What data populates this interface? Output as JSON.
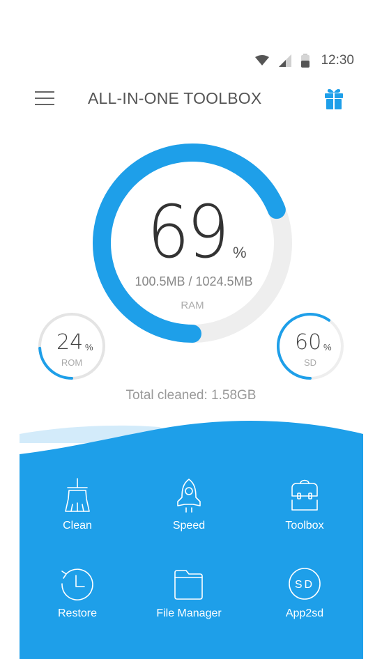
{
  "status_bar": {
    "icons": [
      "wifi-icon",
      "cellular-signal-icon",
      "battery-icon"
    ],
    "time": "12:30"
  },
  "app_bar": {
    "menu_icon": "hamburger-menu-icon",
    "title": "ALL-IN-ONE TOOLBOX",
    "gift_icon": "gift-icon"
  },
  "colors": {
    "accent": "#1e9fe9",
    "accent_light": "#d3ebfa",
    "track": "#eeeeee",
    "track_small": "#e4e4e4",
    "text_dark": "#333333",
    "text_muted": "#999999"
  },
  "ram": {
    "percent": 69,
    "percent_text": "69",
    "percent_sign": "%",
    "usage": "100.5MB / 1024.5MB",
    "label": "RAM"
  },
  "rom": {
    "percent": 24,
    "percent_text": "24",
    "percent_sign": "%",
    "label": "ROM"
  },
  "sd": {
    "percent": 60,
    "percent_text": "60",
    "percent_sign": "%",
    "label": "SD"
  },
  "total_cleaned": "Total cleaned: 1.58GB",
  "tools": [
    {
      "label": "Clean",
      "icon": "broom-icon"
    },
    {
      "label": "Speed",
      "icon": "rocket-icon"
    },
    {
      "label": "Toolbox",
      "icon": "toolbox-icon"
    },
    {
      "label": "Restore",
      "icon": "restore-clock-icon"
    },
    {
      "label": "File Manager",
      "icon": "folder-icon"
    },
    {
      "label": "App2sd",
      "icon": "sd-card-icon",
      "icon_text": "SD"
    }
  ]
}
